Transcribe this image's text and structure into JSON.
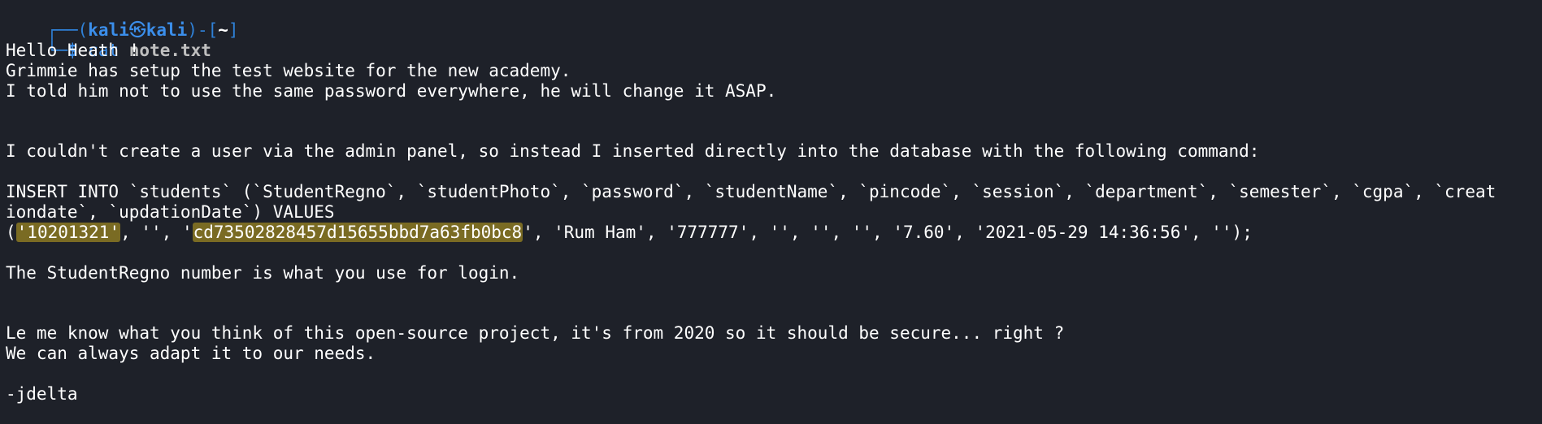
{
  "prompt": {
    "corner_top": "┌──",
    "open_paren": "(",
    "user": "kali",
    "skull": "㉿",
    "host": "kali",
    "close_paren_dash": ")-[",
    "cwd": "~",
    "close_bracket": "]",
    "corner_bottom": "└─",
    "dollar": "$",
    "command": "cat",
    "argument": "note.txt"
  },
  "output": {
    "line1": "Hello Heath !",
    "line2": "Grimmie has setup the test website for the new academy.",
    "line3": "I told him not to use the same password everywhere, he will change it ASAP.",
    "line4": "I couldn't create a user via the admin panel, so instead I inserted directly into the database with the following command:",
    "line5": "INSERT INTO `students` (`StudentRegno`, `studentPhoto`, `password`, `studentName`, `pincode`, `session`, `department`, `semester`, `cgpa`, `creat",
    "line6": "iondate`, `updationDate`) VALUES",
    "line7_open": "(",
    "regno": "'10201321'",
    "line7_mid": ", '', '",
    "hash": "cd73502828457d15655bbd7a63fb0bc8",
    "line7_rest": "', 'Rum Ham', '777777', '', '', '', '7.60', '2021-05-29 14:36:56', '');",
    "line8": "The StudentRegno number is what you use for login.",
    "line9": "Le me know what you think of this open-source project, it's from 2020 so it should be secure... right ?",
    "line10": "We can always adapt it to our needs.",
    "line11": "-jdelta"
  },
  "colors": {
    "background": "#1e2129",
    "prompt_blue": "#3b8eea",
    "highlight": "#7a6b23"
  }
}
